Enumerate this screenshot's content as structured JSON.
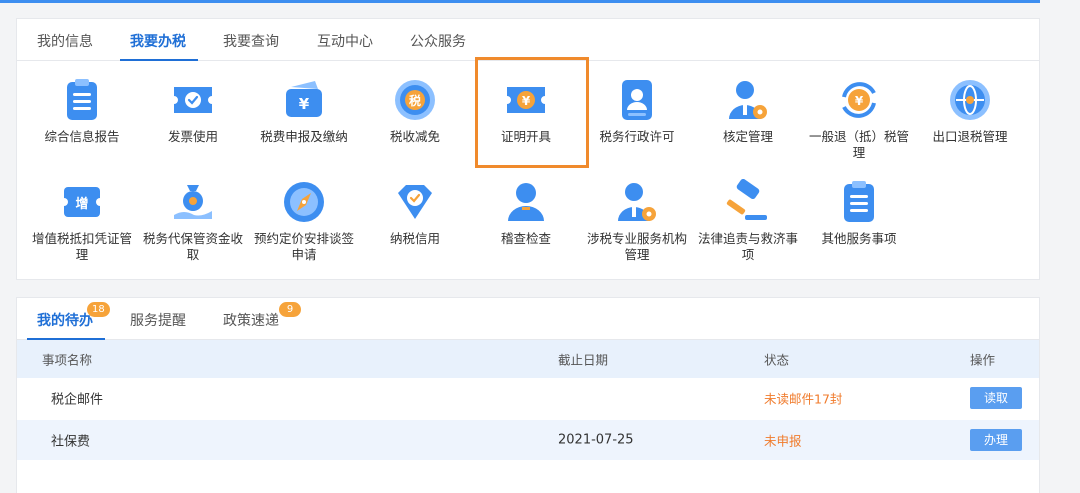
{
  "nav": {
    "tabs": [
      "我的信息",
      "我要办税",
      "我要查询",
      "互动中心",
      "公众服务"
    ],
    "active_tab": "我要办税"
  },
  "services": [
    {
      "label": "综合信息报告",
      "icon": "clipboard-icon"
    },
    {
      "label": "发票使用",
      "icon": "invoice-ticket-icon"
    },
    {
      "label": "税费申报及缴纳",
      "icon": "wallet-yuan-icon"
    },
    {
      "label": "税收减免",
      "icon": "tax-coin-icon"
    },
    {
      "label": "证明开具",
      "icon": "certificate-yuan-icon"
    },
    {
      "label": "税务行政许可",
      "icon": "id-badge-icon"
    },
    {
      "label": "核定管理",
      "icon": "person-gear-icon"
    },
    {
      "label": "一般退（抵）税管理",
      "icon": "yuan-refresh-icon"
    },
    {
      "label": "出口退税管理",
      "icon": "globe-icon"
    },
    {
      "label": "增值税抵扣凭证管理",
      "icon": "vat-voucher-icon"
    },
    {
      "label": "税务代保管资金收取",
      "icon": "money-bag-hand-icon"
    },
    {
      "label": "预约定价安排谈签申请",
      "icon": "compass-icon"
    },
    {
      "label": "纳税信用",
      "icon": "diamond-check-icon"
    },
    {
      "label": "稽查检查",
      "icon": "person-icon"
    },
    {
      "label": "涉税专业服务机构管理",
      "icon": "person-gear-icon"
    },
    {
      "label": "法律追责与救济事项",
      "icon": "gavel-icon"
    },
    {
      "label": "其他服务事项",
      "icon": "clipboard-icon"
    }
  ],
  "highlighted_service": "证明开具",
  "tasks": {
    "tabs": [
      {
        "label": "我的待办",
        "badge": "18"
      },
      {
        "label": "服务提醒"
      },
      {
        "label": "政策速递",
        "badge": "9"
      }
    ],
    "columns": [
      "事项名称",
      "截止日期",
      "状态",
      "操作"
    ],
    "rows": [
      {
        "name": "税企邮件",
        "deadline": "",
        "status": "未读邮件17封",
        "action": "读取"
      },
      {
        "name": "社保费",
        "deadline": "2021-07-25",
        "status": "未申报",
        "action": "办理"
      }
    ]
  },
  "colors": {
    "accent": "#1f6fd6",
    "icon_blue": "#3d8ef0",
    "highlight": "#f08a2c",
    "status": "#f07b2c",
    "button": "#5a9ef0"
  }
}
